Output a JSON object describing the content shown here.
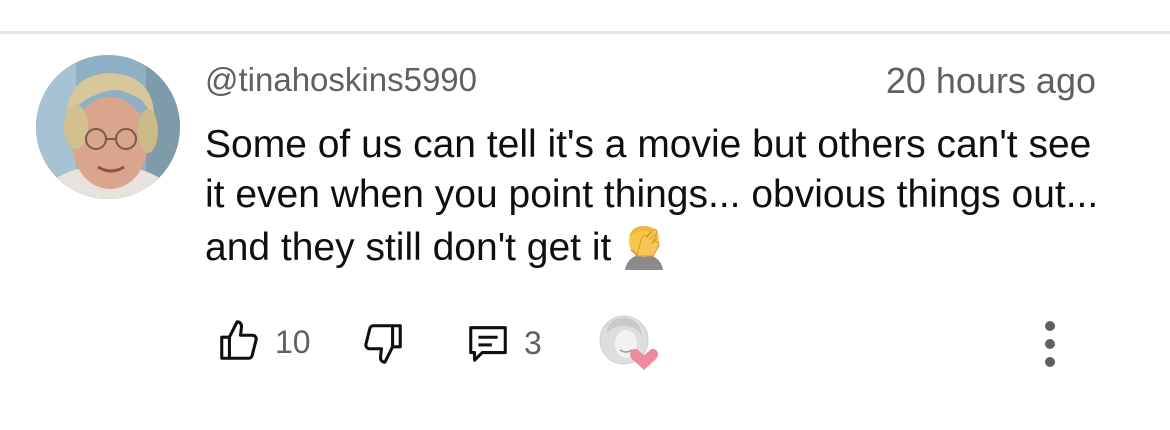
{
  "comment": {
    "author_handle": "@tinahoskins5990",
    "timestamp": "20 hours ago",
    "text": "Some of us can tell it's a movie but others can't see it even when you point things... obvious things out... and they still don't get it",
    "emoji": "face-palm-emoji"
  },
  "actions": {
    "like_count": "10",
    "reply_count": "3",
    "icons": {
      "like": "thumbs-up-icon",
      "dislike": "thumbs-down-icon",
      "reply": "reply-icon",
      "creator_heart": "creator-heart-icon",
      "more": "more-vertical-icon"
    }
  },
  "colors": {
    "text_primary": "#0f0f0f",
    "text_secondary": "#606060",
    "heart": "#f08aa0",
    "divider": "#e6e6e6"
  }
}
